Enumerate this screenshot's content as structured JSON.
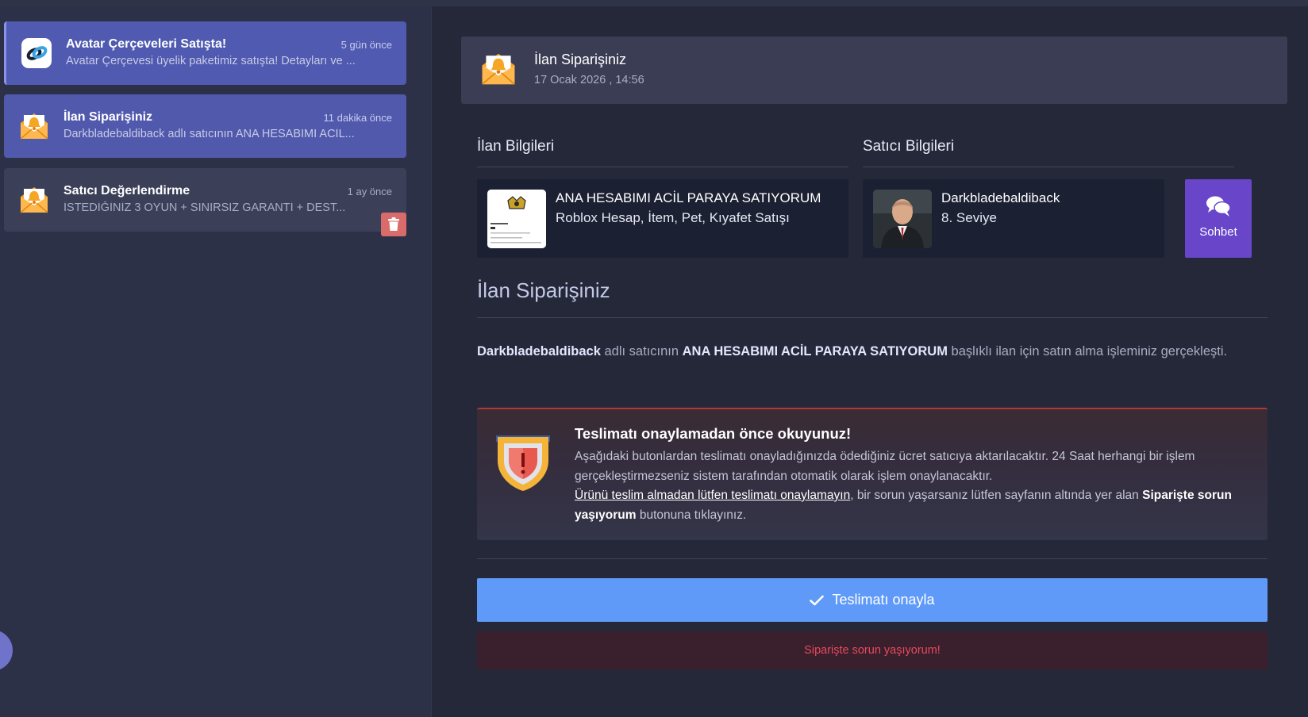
{
  "notifications": [
    {
      "title": "Avatar Çerçeveleri Satışta!",
      "time": "5 gün önce",
      "desc": "Avatar Çerçevesi üyelik paketimiz satışta! Detayları ve ..."
    },
    {
      "title": "İlan Siparişiniz",
      "time": "11 dakika önce",
      "desc": "Darkbladebaldiback adlı satıcının ANA HESABIMI ACİL..."
    },
    {
      "title": "Satıcı Değerlendirme",
      "time": "1 ay önce",
      "desc": "İSTEDİĞİNİZ 3 OYUN + SINIRSIZ GARANTİ + DEST..."
    }
  ],
  "header": {
    "title": "İlan Siparişiniz",
    "date": "17 Ocak 2026 , 14:56"
  },
  "sections": {
    "listing_title": "İlan Bilgileri",
    "seller_title": "Satıcı Bilgileri"
  },
  "listing": {
    "name": "ANA HESABIMI ACİL PARAYA SATIYORUM",
    "category": "Roblox Hesap, İtem, Pet, Kıyafet Satışı"
  },
  "seller": {
    "name": "Darkbladebaldiback",
    "level": "8. Seviye",
    "chat_label": "Sohbet"
  },
  "order": {
    "title": "İlan Siparişiniz",
    "seller_name": "Darkbladebaldiback",
    "text_1": " adlı satıcının ",
    "listing_name": "ANA HESABIMI ACİL PARAYA SATIYORUM",
    "text_2": " başlıklı ilan için satın alma işleminiz gerçekleşti."
  },
  "warning": {
    "title": "Teslimatı onaylamadan önce okuyunuz!",
    "body_1": "Aşağıdaki butonlardan teslimatı onayladığınızda ödediğiniz ücret satıcıya aktarılacaktır. 24 Saat herhangi bir işlem gerçekleştirmezseniz sistem tarafından otomatik olarak işlem onaylanacaktır.",
    "underline": "Ürünü teslim almadan lütfen teslimatı onaylamayın",
    "body_2": ", bir sorun yaşarsanız lütfen sayfanın altında yer alan ",
    "bold": "Siparişte sorun yaşıyorum",
    "body_3": " butonuna tıklayınız."
  },
  "buttons": {
    "confirm": "Teslimatı onayla",
    "problem": "Siparişte sorun yaşıyorum!"
  },
  "icons": {
    "notif1": "link-logo-icon",
    "notif": "bell-envelope-icon",
    "delete": "trash-icon",
    "chat": "chat-bubbles-icon",
    "check": "check-icon",
    "shield": "shield-warning-icon"
  },
  "colors": {
    "accent": "#5159ad",
    "confirm": "#5f9af8",
    "chat": "#6845c9",
    "danger": "#e84a5f",
    "delete": "#d96b6b"
  }
}
